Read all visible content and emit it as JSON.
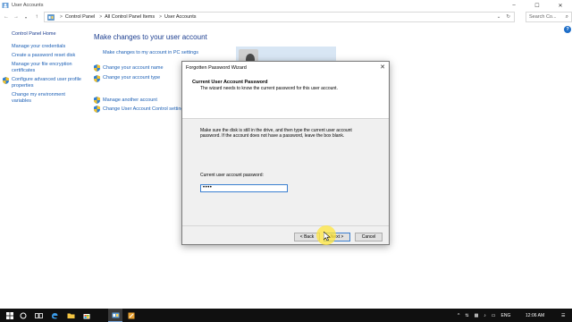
{
  "window": {
    "title": "User Accounts",
    "controls": [
      "–",
      "☐",
      "✕"
    ]
  },
  "address": {
    "crumbs": [
      "Control Panel",
      "All Control Panel Items",
      "User Accounts"
    ],
    "separator": ">",
    "search_placeholder": "Search Co..."
  },
  "sidebar": {
    "home": "Control Panel Home",
    "items": [
      {
        "label": "Manage your credentials"
      },
      {
        "label": "Create a password reset disk"
      },
      {
        "label": "Manage your file encryption certificates"
      },
      {
        "label": "Configure advanced user profile properties"
      },
      {
        "label": "Change my environment variables"
      }
    ]
  },
  "main": {
    "title": "Make changes to your user account",
    "links": {
      "pc_settings": "Make changes to my account in PC settings",
      "change_name": "Change your account name",
      "change_type": "Change your account type",
      "manage_other": "Manage another account",
      "uac": "Change User Account Control settings"
    }
  },
  "dialog": {
    "title": "Forgotten Password Wizard",
    "heading": "Current User Account Password",
    "subheading": "The wizard needs to know the current password for this user account.",
    "body": "Make sure the disk is still in the drive, and then type the current user account password. If the account does not have a password, leave the box blank.",
    "password_label": "Current user account password:",
    "password_value": "••••",
    "buttons": {
      "back": "< Back",
      "next": "Next >",
      "cancel": "Cancel"
    }
  },
  "taskbar": {
    "language": "ENG",
    "time": "12:06 AM"
  },
  "colors": {
    "link": "#1b5fb5",
    "heading": "#1b3d8f",
    "taskbar": "#101010"
  }
}
